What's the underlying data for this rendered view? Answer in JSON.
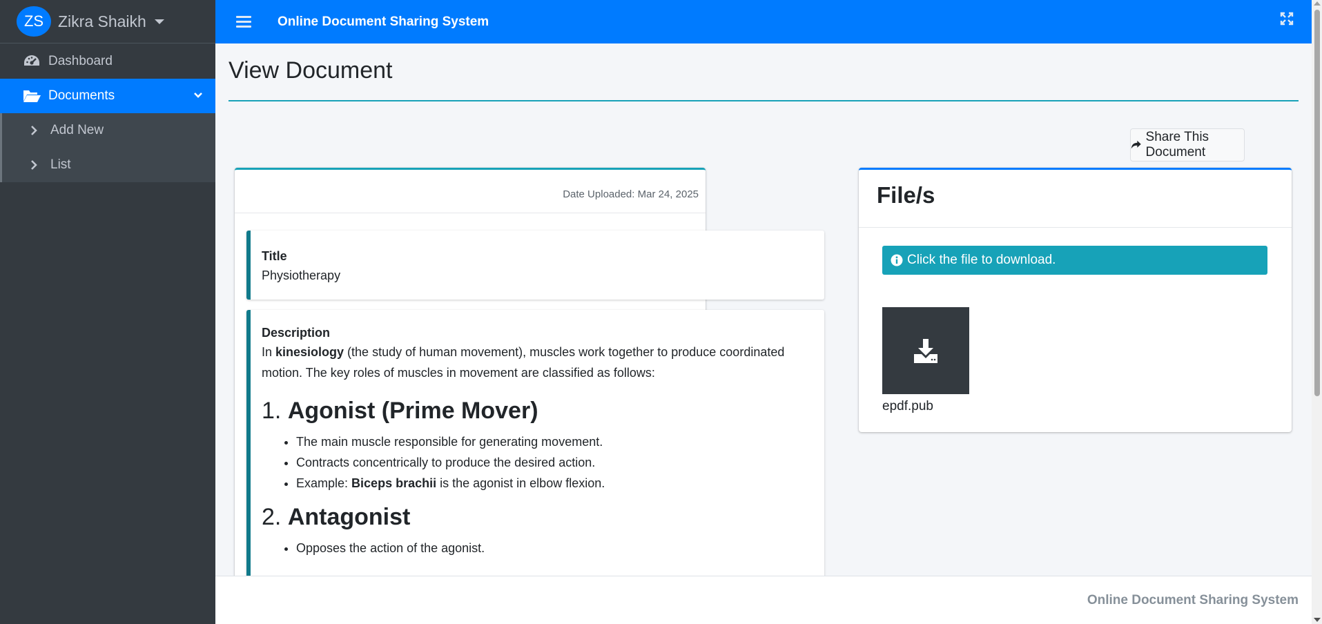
{
  "sidebar": {
    "avatar_initials": "ZS",
    "user_name": "Zikra Shaikh",
    "items": [
      {
        "label": "Dashboard",
        "icon": "tachometer-icon"
      },
      {
        "label": "Documents",
        "icon": "folder-open-icon",
        "active": true
      }
    ],
    "subitems": [
      {
        "label": "Add New",
        "icon": "chevron-right-icon"
      },
      {
        "label": "List",
        "icon": "chevron-right-icon"
      }
    ]
  },
  "header": {
    "title": "Online Document Sharing System"
  },
  "page": {
    "title": "View Document",
    "share_label": "Share This Document"
  },
  "document": {
    "date_uploaded": "Date Uploaded: Mar 24, 2025",
    "title_label": "Title",
    "title_value": "Physiotherapy",
    "description_label": "Description",
    "intro_pre": "In ",
    "intro_bold": "kinesiology",
    "intro_post": " (the study of human movement), muscles work together to produce coordinated motion. The key roles of muscles in movement are classified as follows:",
    "section1_num": "1. ",
    "section1_title": "Agonist (Prime Mover)",
    "section1_bullet1": "The main muscle responsible for generating movement.",
    "section1_bullet2": "Contracts concentrically to produce the desired action.",
    "section1_bullet3_pre": "Example: ",
    "section1_bullet3_bold": "Biceps brachii",
    "section1_bullet3_post": " is the agonist in elbow flexion.",
    "section2_num": "2. ",
    "section2_title": "Antagonist",
    "section2_bullet1": "Opposes the action of the agonist."
  },
  "files": {
    "title": "File/s",
    "alert": "Click the file to download.",
    "file_name": "epdf.pub"
  },
  "footer": {
    "text": "Online Document Sharing System"
  },
  "colors": {
    "primary": "#007bff",
    "info": "#17a2b8",
    "sidebar_bg": "#343a40",
    "callout_border": "#117a8b"
  }
}
